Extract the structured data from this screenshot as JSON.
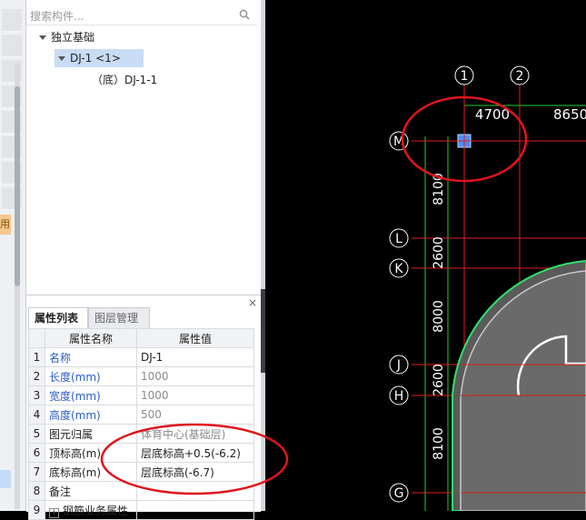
{
  "search": {
    "placeholder": "搜索构件..."
  },
  "tree": {
    "root_label": "独立基础",
    "child_label": "DJ-1 <1>",
    "leaf_label": "（底）DJ-1-1"
  },
  "left_strip": {
    "tag_label": "用"
  },
  "properties": {
    "tabs": [
      "属性列表",
      "图层管理"
    ],
    "headers": [
      "属性名称",
      "属性值"
    ],
    "rows": [
      {
        "num": "1",
        "name": "名称",
        "value": "DJ-1"
      },
      {
        "num": "2",
        "name": "长度(mm)",
        "value": "1000"
      },
      {
        "num": "3",
        "name": "宽度(mm)",
        "value": "1000"
      },
      {
        "num": "4",
        "name": "高度(mm)",
        "value": "500"
      },
      {
        "num": "5",
        "name": "图元归属",
        "value": "体育中心(基础层)"
      },
      {
        "num": "6",
        "name": "顶标高(m)",
        "value": "层底标高+0.5(-6.2)"
      },
      {
        "num": "7",
        "name": "底标高(m)",
        "value": "层底标高(-6.7)"
      },
      {
        "num": "8",
        "name": "备注",
        "value": ""
      },
      {
        "num": "9",
        "name": "钢筋业务属性",
        "value": ""
      }
    ],
    "close_label": "×"
  },
  "cad": {
    "axis_cols": [
      "1",
      "2"
    ],
    "axis_rows": [
      "M",
      "L",
      "K",
      "J",
      "H",
      "G"
    ],
    "dim_horizontal": [
      "4700",
      "8650"
    ],
    "dim_vertical": [
      "8100",
      "2600",
      "8000",
      "2600",
      "8100"
    ],
    "colors": {
      "grid": "#e01e1e",
      "dim": "#1fd11f",
      "annotation": "#e0141c",
      "selection": "#4c8ef0"
    }
  }
}
